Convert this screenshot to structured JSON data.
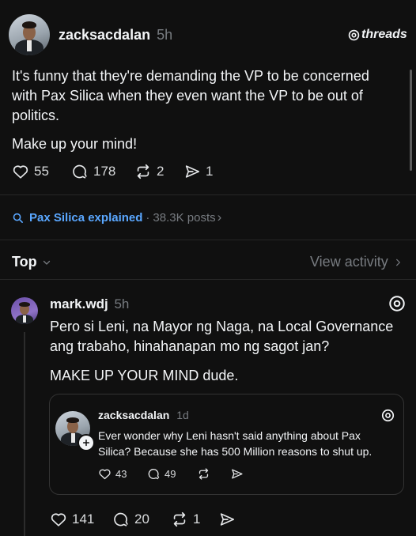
{
  "post": {
    "username": "zacksacdalan",
    "time": "5h",
    "brand": "threads",
    "body_line1": "It's funny that they're demanding the VP to be concerned",
    "body_line2": "with Pax Silica when they even want the VP to be out of",
    "body_line3": "politics.",
    "body_line4": "Make up your mind!",
    "likes": "55",
    "replies": "178",
    "reposts": "2",
    "shares": "1"
  },
  "topic": {
    "label": "Pax Silica explained",
    "separator": "·",
    "count": "38.3K posts",
    "chevron": "›"
  },
  "sort": {
    "label": "Top",
    "view_activity": "View activity"
  },
  "reply": {
    "username": "mark.wdj",
    "time": "5h",
    "body_line1": "Pero si Leni, na Mayor ng Naga, na Local Governance",
    "body_line2": "ang trabaho, hinahanapan mo ng sagot jan?",
    "body_line3": "MAKE UP YOUR MIND dude.",
    "likes": "141",
    "replies": "20",
    "reposts": "1"
  },
  "quote": {
    "username": "zacksacdalan",
    "time": "1d",
    "body_line1": "Ever wonder why Leni hasn't said anything about Pax",
    "body_line2": "Silica? Because she has 500 Million reasons to shut up.",
    "likes": "43",
    "replies": "49"
  },
  "colors": {
    "background": "#101010",
    "accent_blue": "#5aa7ff",
    "muted": "#777b80"
  }
}
